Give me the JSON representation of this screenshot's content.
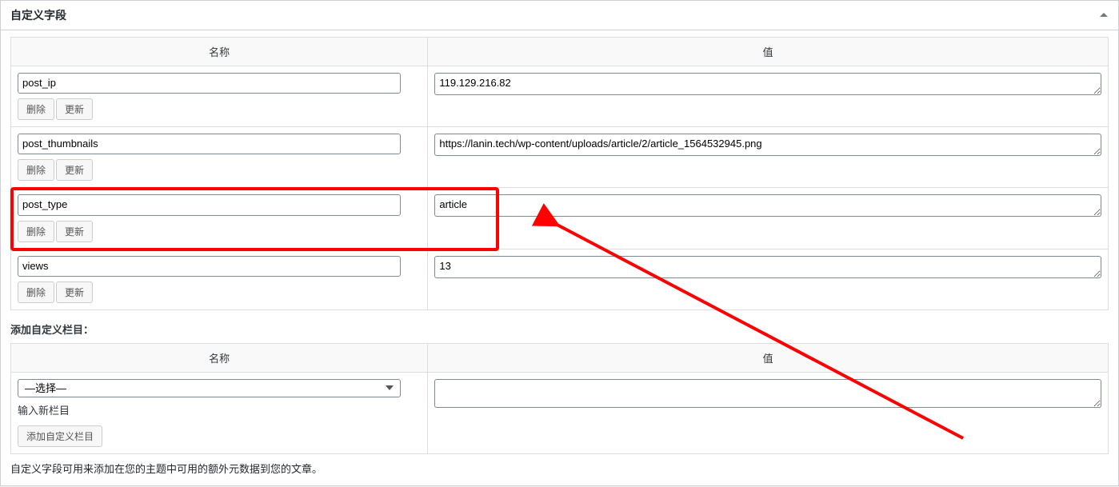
{
  "panel": {
    "title": "自定义字段",
    "headers": {
      "name": "名称",
      "value": "值"
    },
    "rows": [
      {
        "key": "post_ip",
        "value": "119.129.216.82",
        "delete": "删除",
        "update": "更新",
        "highlight": false
      },
      {
        "key": "post_thumbnails",
        "value": "https://lanin.tech/wp-content/uploads/article/2/article_1564532945.png",
        "delete": "删除",
        "update": "更新",
        "highlight": false
      },
      {
        "key": "post_type",
        "value": "article",
        "delete": "删除",
        "update": "更新",
        "highlight": true
      },
      {
        "key": "views",
        "value": "13",
        "delete": "删除",
        "update": "更新",
        "highlight": false
      }
    ],
    "add": {
      "label": "添加自定义栏目：",
      "select_placeholder": "—选择—",
      "input_new_link": "输入新栏目",
      "add_button": "添加自定义栏目"
    },
    "help": "自定义字段可用来添加在您的主题中可用的额外元数据到您的文章。"
  }
}
